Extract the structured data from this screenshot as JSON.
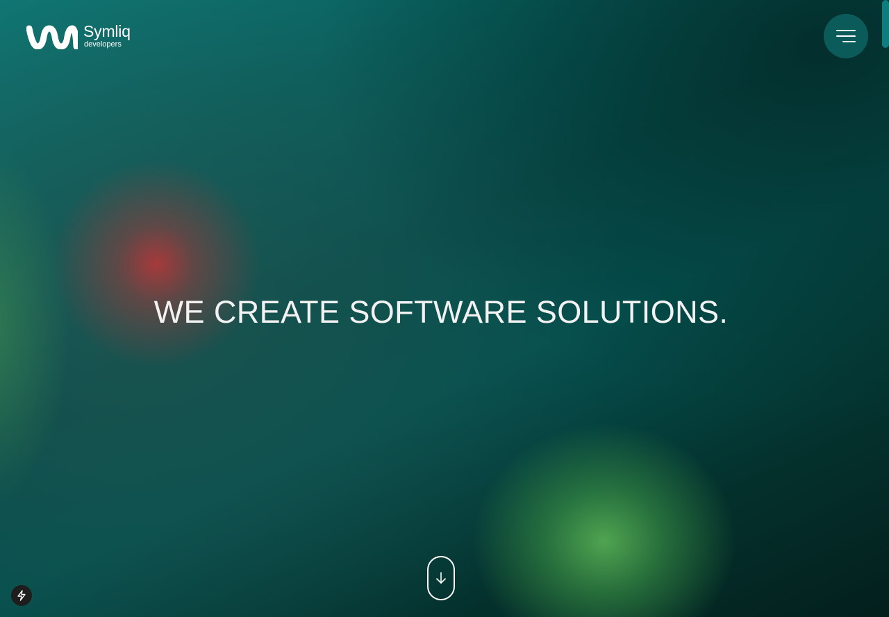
{
  "brand": {
    "name": "Symliq",
    "subtitle": "developers",
    "logo_icon": "symliq-wave-logo-icon"
  },
  "header": {
    "menu_icon": "hamburger-menu-icon"
  },
  "hero": {
    "headline": "WE CREATE SOFTWARE SOLUTIONS.",
    "scroll_icon": "arrow-down-icon"
  },
  "badge": {
    "icon": "lightning-bolt-icon"
  },
  "colors": {
    "background_teal": "#07615f",
    "background_dark": "#031f1c",
    "menu_button": "#0b5b5a",
    "glow_red": "#ae383a",
    "glow_green": "#54aa52",
    "text": "#f2f2f2"
  }
}
